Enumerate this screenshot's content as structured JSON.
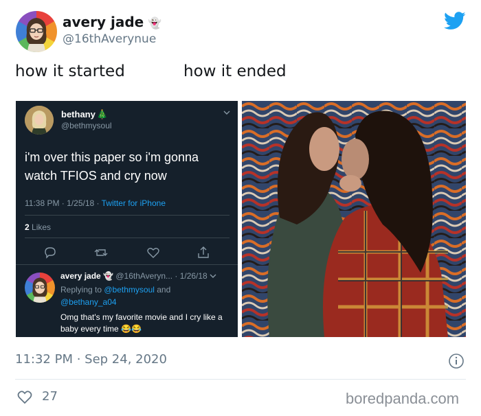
{
  "tweet": {
    "author": {
      "display_name": "avery jade",
      "name_emoji": "👻",
      "handle": "@16thAverynue",
      "avatar_icon": "avatar-girl-glasses-rainbow-bg"
    },
    "brand_icon": "twitter-bird-icon",
    "brand_color": "#1da1f2",
    "caption_left": "how it started",
    "caption_right": "how it ended",
    "timestamp": "11:32 PM · Sep 24, 2020",
    "like_count": "27"
  },
  "embedded_tweet": {
    "author_name": "bethany",
    "author_emoji": "🎄",
    "author_handle": "@bethmysoul",
    "text": "i'm over this paper so i'm gonna watch TFIOS and cry now",
    "meta_time": "11:38 PM · 1/25/18 · ",
    "meta_client": "Twitter for iPhone",
    "likes_count": "2",
    "likes_label": "Likes",
    "background_color": "#15202b",
    "reply": {
      "author_name": "avery jade",
      "author_emoji": "👻",
      "handle_date": "@16thAveryn... · 1/26/18",
      "replying_prefix": "Replying to ",
      "replying_to_1": "@bethmysoul",
      "replying_and": " and ",
      "replying_to_2": "@bethany_a04",
      "text": "Omg that's my favorite movie and I cry like a baby every time 😂😂"
    }
  },
  "photo": {
    "alt_icon": "couple-kissing-photo"
  },
  "watermark": "boredpanda.com"
}
